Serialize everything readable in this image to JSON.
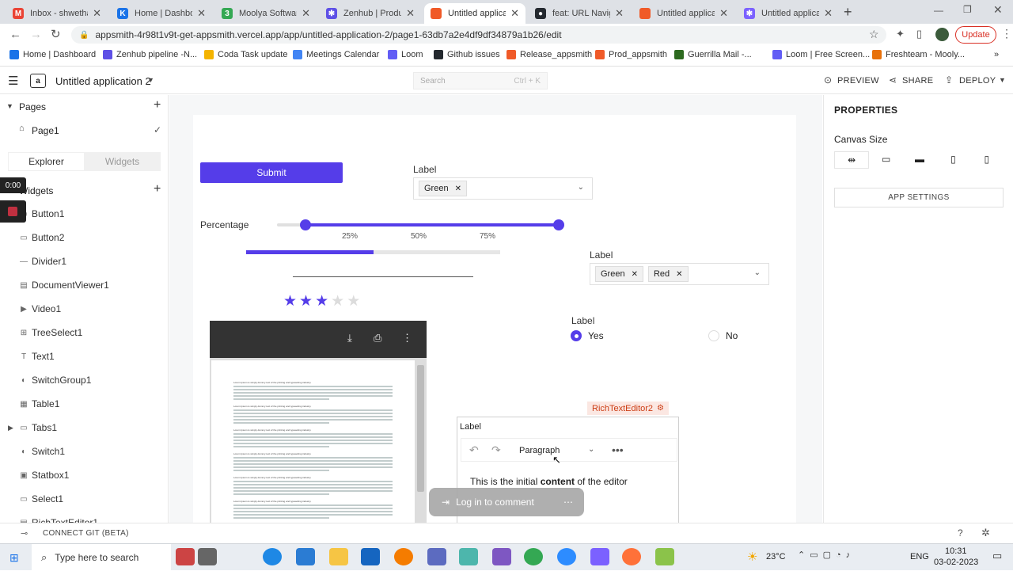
{
  "browser": {
    "tabs": [
      {
        "title": "Inbox - shwetha.n",
        "color": "#ea4335",
        "glyph": "M"
      },
      {
        "title": "Home | Dashboard",
        "color": "#1a73e8",
        "glyph": "K"
      },
      {
        "title": "Moolya Software",
        "color": "#34a853",
        "glyph": "3"
      },
      {
        "title": "Zenhub | Product",
        "color": "#5e50e6",
        "glyph": "✱"
      },
      {
        "title": "Untitled applicat",
        "color": "#f05a28",
        "glyph": ""
      },
      {
        "title": "feat: URL Navigat",
        "color": "#24292f",
        "glyph": "●"
      },
      {
        "title": "Untitled applicat",
        "color": "#f05a28",
        "glyph": ""
      },
      {
        "title": "Untitled applicat",
        "color": "#7b61ff",
        "glyph": "✱"
      }
    ],
    "url": "appsmith-4r98t1v9t-get-appsmith.vercel.app/app/untitled-application-2/page1-63db7a2e4df9df34879a1b26/edit",
    "update_label": "Update",
    "bookmarks": [
      {
        "label": "Home | Dashboard",
        "color": "#1a73e8"
      },
      {
        "label": "Zenhub pipeline -N...",
        "color": "#5e50e6"
      },
      {
        "label": "Coda Task update",
        "color": "#f4b400"
      },
      {
        "label": "Meetings Calendar",
        "color": "#4285f4"
      },
      {
        "label": "Loom",
        "color": "#625df5"
      },
      {
        "label": "Github issues",
        "color": "#24292f"
      },
      {
        "label": "Release_appsmith",
        "color": "#f05a28"
      },
      {
        "label": "Prod_appsmith",
        "color": "#f05a28"
      },
      {
        "label": "Guerrilla Mail -...",
        "color": "#2d6a1f"
      },
      {
        "label": "Loom | Free Screen...",
        "color": "#625df5"
      },
      {
        "label": "Freshteam - Mooly...",
        "color": "#e8710a"
      }
    ]
  },
  "app": {
    "title": "Untitled application 2",
    "search_placeholder": "Search",
    "search_shortcut": "Ctrl + K",
    "preview": "PREVIEW",
    "share": "SHARE",
    "deploy": "DEPLOY"
  },
  "sidebar": {
    "pages_heading": "Pages",
    "page1": "Page1",
    "tab_explorer": "Explorer",
    "tab_widgets": "Widgets",
    "widgets_heading": "Widgets",
    "timer": "0:00",
    "items": [
      {
        "label": "Button1",
        "icon": "▭"
      },
      {
        "label": "Button2",
        "icon": "▭"
      },
      {
        "label": "Divider1",
        "icon": "—"
      },
      {
        "label": "DocumentViewer1",
        "icon": "▤"
      },
      {
        "label": "Video1",
        "icon": "▶"
      },
      {
        "label": "TreeSelect1",
        "icon": "⊞"
      },
      {
        "label": "Text1",
        "icon": "T"
      },
      {
        "label": "SwitchGroup1",
        "icon": "◐"
      },
      {
        "label": "Table1",
        "icon": "▦"
      },
      {
        "label": "Tabs1",
        "icon": "▭"
      },
      {
        "label": "Switch1",
        "icon": "◐"
      },
      {
        "label": "Statbox1",
        "icon": "▣"
      },
      {
        "label": "Select1",
        "icon": "▭"
      },
      {
        "label": "RichTextEditor1",
        "icon": "▤"
      }
    ],
    "connect_git": "CONNECT GIT (BETA)"
  },
  "canvas": {
    "submit_label": "Submit",
    "select1_label": "Label",
    "select1_chip": "Green",
    "slider_label": "Percentage",
    "slider_ticks": [
      "25%",
      "50%",
      "75%"
    ],
    "slider_low": 0.1,
    "slider_high": 1.0,
    "progress": 0.5,
    "rating_value": 3,
    "rating_max": 5,
    "multiselect_label": "Label",
    "multiselect_chips": [
      "Green",
      "Red"
    ],
    "radio_label": "Label",
    "radio_options": [
      "Yes",
      "No"
    ],
    "rte_tag": "RichTextEditor2",
    "rte_label": "Label",
    "rte_block": "Paragraph",
    "rte_text_pre": "This is the initial ",
    "rte_text_bold": "content",
    "rte_text_post": " of the editor",
    "comment_label": "Log in to comment",
    "doc_paragraph": "Lorem Ipsum is simply dummy text of the printing and typesetting industry."
  },
  "properties": {
    "heading": "PROPERTIES",
    "canvas_size": "Canvas Size",
    "app_settings": "APP SETTINGS"
  },
  "taskbar": {
    "search_placeholder": "Type here to search",
    "temperature": "23°C",
    "lang": "ENG",
    "time": "10:31",
    "date": "03-02-2023"
  },
  "colors": {
    "accent": "#553de9",
    "rating": "#553de9"
  }
}
